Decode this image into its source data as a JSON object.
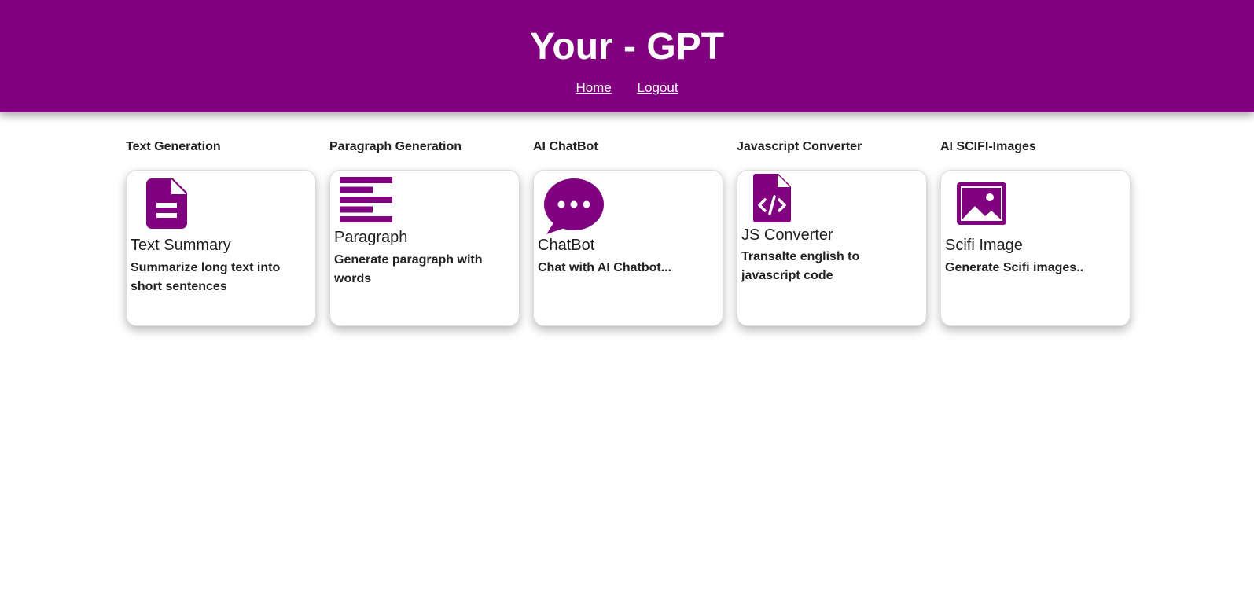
{
  "header": {
    "title": "Your - GPT",
    "nav": {
      "home": "Home",
      "logout": "Logout"
    }
  },
  "theme": {
    "accent": "#800080",
    "background": "#ffffff"
  },
  "sections": [
    {
      "heading": "Text Generation",
      "card": {
        "icon": "document-icon",
        "title": "Text Summary",
        "description": "Summarize long text into short sentences"
      }
    },
    {
      "heading": "Paragraph Generation",
      "card": {
        "icon": "paragraph-align-icon",
        "title": "Paragraph",
        "description": "Generate paragraph with words"
      }
    },
    {
      "heading": "AI ChatBot",
      "card": {
        "icon": "chat-bubble-icon",
        "title": "ChatBot",
        "description": "Chat with AI Chatbot..."
      }
    },
    {
      "heading": "Javascript Converter",
      "card": {
        "icon": "code-file-icon",
        "title": "JS Converter",
        "description": "Transalte english to javascript code"
      }
    },
    {
      "heading": "AI SCIFI-Images",
      "card": {
        "icon": "image-icon",
        "title": "Scifi Image",
        "description": "Generate Scifi images.."
      }
    }
  ]
}
